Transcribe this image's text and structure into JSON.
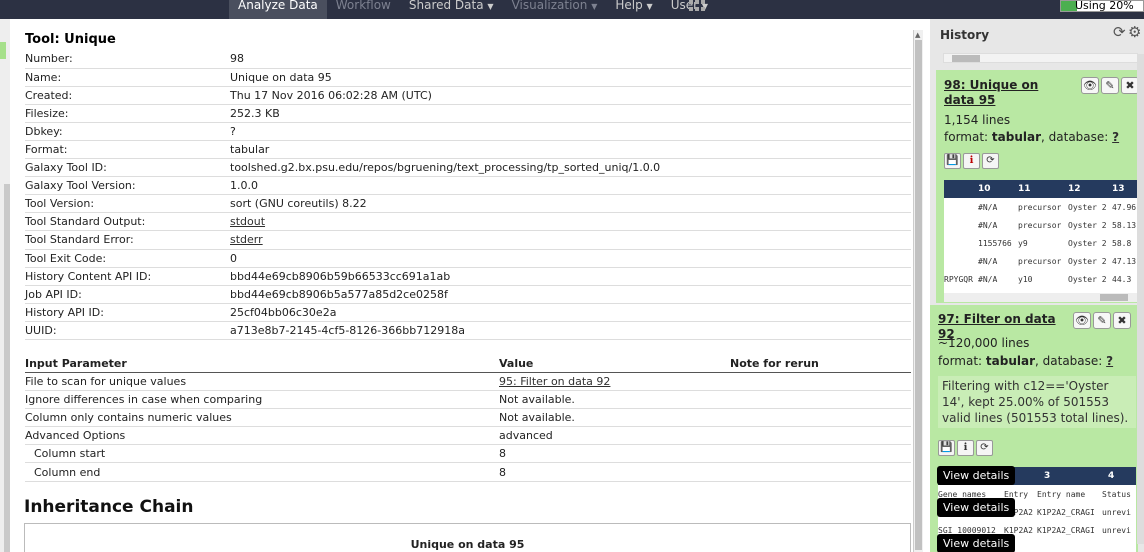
{
  "masthead": {
    "nav": [
      {
        "label": "Analyze Data",
        "dropdown": false,
        "state": "active"
      },
      {
        "label": "Workflow",
        "dropdown": false,
        "state": "dim"
      },
      {
        "label": "Shared Data",
        "dropdown": true,
        "state": "normal"
      },
      {
        "label": "Visualization",
        "dropdown": true,
        "state": "dim"
      },
      {
        "label": "Help",
        "dropdown": true,
        "state": "normal"
      },
      {
        "label": "User",
        "dropdown": true,
        "state": "normal"
      }
    ],
    "quota_label": "Using 20%",
    "quota_percent": 20
  },
  "tool": {
    "title": "Tool: Unique",
    "info": [
      {
        "key": "Number:",
        "value": "98"
      },
      {
        "key": "Name:",
        "value": "Unique on data 95"
      },
      {
        "key": "Created:",
        "value": "Thu 17 Nov 2016 06:02:28 AM (UTC)"
      },
      {
        "key": "Filesize:",
        "value": "252.3 KB"
      },
      {
        "key": "Dbkey:",
        "value": "?"
      },
      {
        "key": "Format:",
        "value": "tabular"
      },
      {
        "key": "Galaxy Tool ID:",
        "value": "toolshed.g2.bx.psu.edu/repos/bgruening/text_processing/tp_sorted_uniq/1.0.0"
      },
      {
        "key": "Galaxy Tool Version:",
        "value": "1.0.0"
      },
      {
        "key": "Tool Version:",
        "value": "sort (GNU coreutils) 8.22"
      },
      {
        "key": "Tool Standard Output:",
        "value": "stdout",
        "link": true
      },
      {
        "key": "Tool Standard Error:",
        "value": "stderr",
        "link": true
      },
      {
        "key": "Tool Exit Code:",
        "value": "0"
      },
      {
        "key": "History Content API ID:",
        "value": "bbd44e69cb8906b59b66533cc691a1ab"
      },
      {
        "key": "Job API ID:",
        "value": "bbd44e69cb8906b5a577a85d2ce0258f"
      },
      {
        "key": "History API ID:",
        "value": "25cf04bb06c30e2a"
      },
      {
        "key": "UUID:",
        "value": "a713e8b7-2145-4cf5-8126-366bb712918a"
      }
    ]
  },
  "params": {
    "headers": [
      "Input Parameter",
      "Value",
      "Note for rerun"
    ],
    "rows": [
      {
        "name": "File to scan for unique values",
        "value": "95: Filter on data 92",
        "link": true
      },
      {
        "name": "Ignore differences in case when comparing",
        "value": "Not available."
      },
      {
        "name": "Column only contains numeric values",
        "value": "Not available."
      },
      {
        "name": "Advanced Options",
        "value": "advanced"
      },
      {
        "name": "Column start",
        "value": "8",
        "indent": true
      },
      {
        "name": "Column end",
        "value": "8",
        "indent": true
      }
    ]
  },
  "inheritance": {
    "title": "Inheritance Chain",
    "item": "Unique on data 95"
  },
  "history": {
    "title": "History",
    "datasets": [
      {
        "title": "98: Unique on data 95",
        "lines": "1,154 lines",
        "format_label": "format: ",
        "format": "tabular",
        "db_label": ", database: ",
        "db": "?",
        "peek_headers": [
          "10",
          "11",
          "12",
          "13"
        ],
        "peek_rows": [
          [
            "",
            "#N/A",
            "precursor",
            "Oyster 2",
            "47.96"
          ],
          [
            "",
            "#N/A",
            "precursor",
            "Oyster 2",
            "58.13"
          ],
          [
            "",
            "1155766",
            "y9",
            "Oyster 2",
            "58.8"
          ],
          [
            "",
            "#N/A",
            "precursor",
            "Oyster 2",
            "47.13"
          ],
          [
            "RPYGQR",
            "#N/A",
            "y10",
            "Oyster 2",
            "44.3"
          ]
        ]
      },
      {
        "title": "97: Filter on data 92",
        "lines": "~120,000 lines",
        "format_label": "format: ",
        "format": "tabular",
        "db_label": ", database: ",
        "db": "?",
        "info": "Filtering with c12=='Oyster 14', kept 25.00% of 501553 valid lines (501553 total lines).",
        "peek_headers": [
          "",
          "3",
          "4"
        ],
        "peek_rows": [
          [
            "Gene names",
            "Entry",
            "Entry name",
            "Status"
          ],
          [
            "",
            "K1P2A2",
            "K1P2A2_CRAGI",
            "unrevi"
          ],
          [
            "SGI_10009012",
            "K1P2A2",
            "K1P2A2_CRAGI",
            "unrevi"
          ]
        ]
      }
    ],
    "tooltips": [
      "View details",
      "View details",
      "View details"
    ]
  }
}
